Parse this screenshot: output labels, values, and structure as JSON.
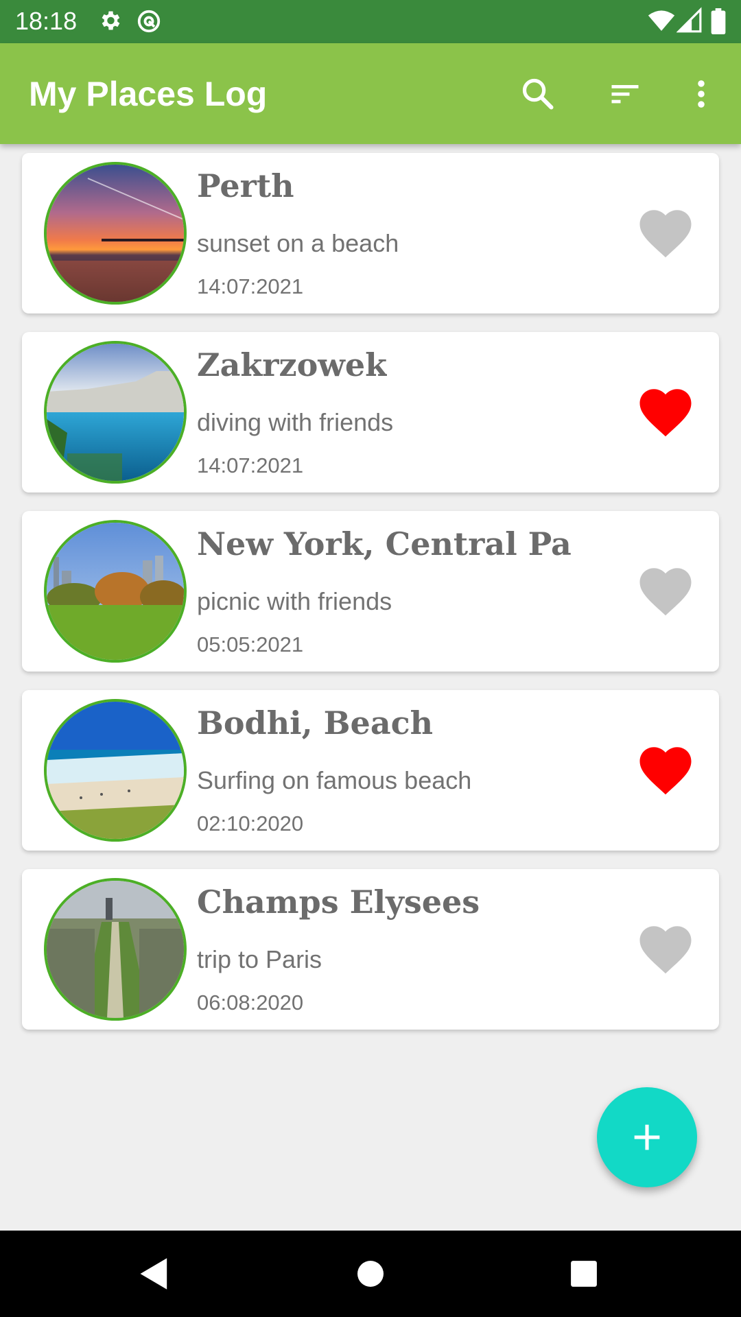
{
  "status_bar": {
    "time": "18:18",
    "icons": [
      "settings-icon",
      "at-sign-icon",
      "wifi-icon",
      "signal-icon",
      "battery-icon"
    ]
  },
  "app_bar": {
    "title": "My Places Log",
    "actions": [
      "search-icon",
      "sort-icon",
      "more-vert-icon"
    ]
  },
  "places": [
    {
      "title": "Perth",
      "description": "sunset on a beach",
      "date": "14:07:2021",
      "favorite": false
    },
    {
      "title": "Zakrzowek",
      "description": "diving with friends",
      "date": "14:07:2021",
      "favorite": true
    },
    {
      "title": "New York, Central Pa",
      "description": "picnic with friends",
      "date": "05:05:2021",
      "favorite": false
    },
    {
      "title": "Bodhi, Beach",
      "description": "Surfing on famous beach",
      "date": "02:10:2020",
      "favorite": true
    },
    {
      "title": "Champs Elysees",
      "description": "trip to Paris",
      "date": "06:08:2020",
      "favorite": false
    }
  ],
  "fab": {
    "icon": "plus-icon"
  },
  "colors": {
    "status_bar": "#3a8a3c",
    "app_bar": "#8bc34a",
    "favorite_on": "#ff0000",
    "favorite_off": "#c4c4c4",
    "fab": "#12d9c6",
    "thumb_border": "#4caf26"
  }
}
